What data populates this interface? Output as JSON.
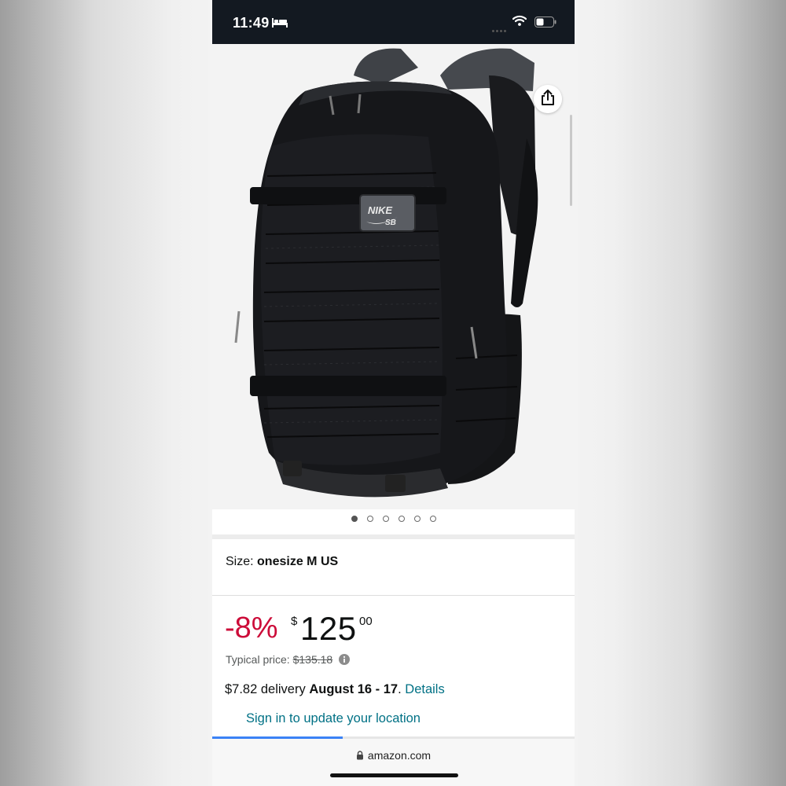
{
  "status_bar": {
    "time": "11:49",
    "icons": [
      "bed-icon",
      "wifi-icon",
      "battery-icon"
    ]
  },
  "gallery": {
    "image_alt": "Nike SB backpack product image",
    "logo_text": "NIKE SB",
    "page_count": 6,
    "active_page": 1,
    "share_icon": "share-icon"
  },
  "product": {
    "size_label": "Size:",
    "size_value": "onesize M US",
    "discount": "-8%",
    "currency_symbol": "$",
    "price_whole": "125",
    "price_fraction": "00",
    "typical_label": "Typical price:",
    "typical_price": "$135.18",
    "delivery_prefix": "$7.82 delivery ",
    "delivery_dates": "August 16 - 17",
    "delivery_suffix": ". ",
    "details_link": "Details",
    "signin_link": "Sign in to update your location"
  },
  "browser": {
    "url": "amazon.com",
    "load_progress": 0.36
  },
  "colors": {
    "discount": "#cc0c39",
    "link": "#007185",
    "status_bar": "#131921",
    "progress": "#3b82f6"
  }
}
